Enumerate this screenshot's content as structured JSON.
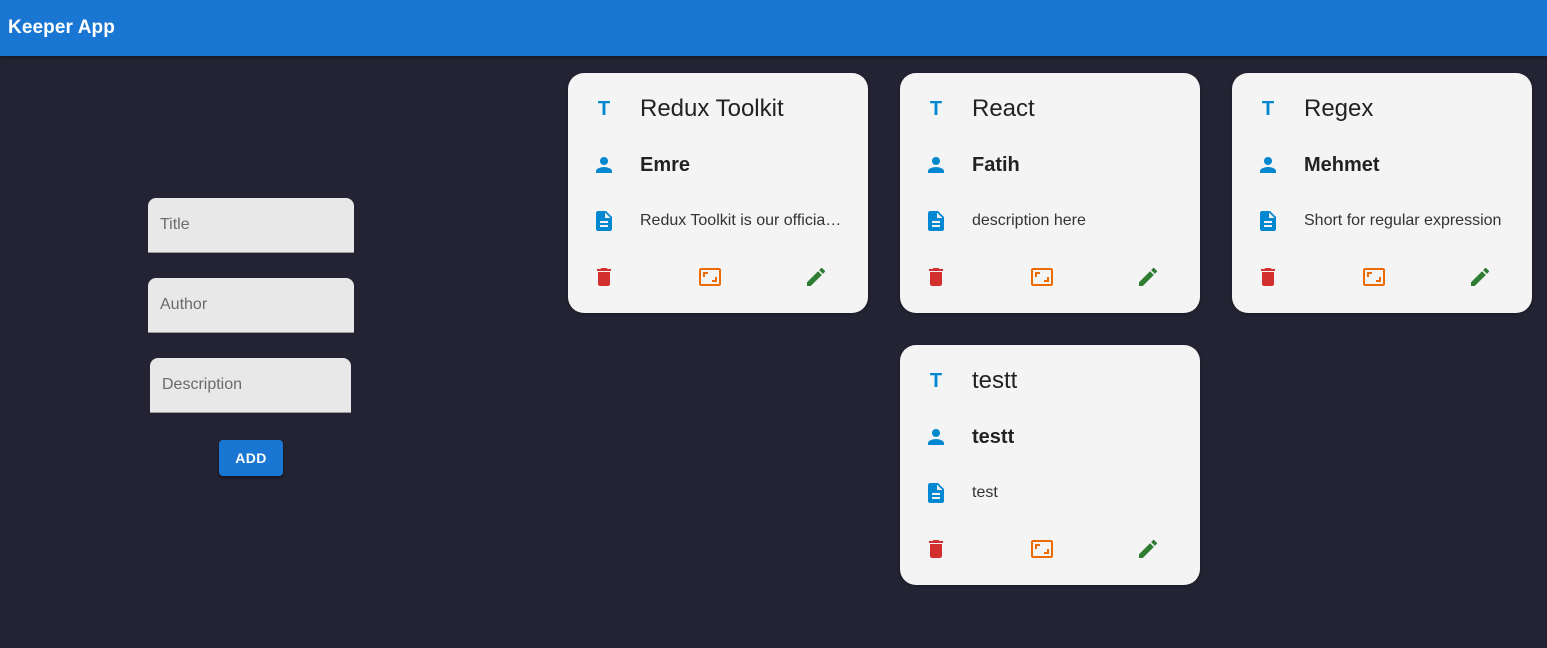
{
  "app": {
    "title": "Keeper App"
  },
  "form": {
    "title_placeholder": "Title",
    "author_placeholder": "Author",
    "description_placeholder": "Description",
    "add_label": "ADD"
  },
  "colors": {
    "appbar": "#1976d2",
    "background": "#232333",
    "card": "#f4f4f4",
    "info_icon": "#0288d1",
    "delete_icon": "#d32f2f",
    "expand_icon": "#ed6c02",
    "edit_icon": "#2e7d32"
  },
  "notes": [
    {
      "title": "Redux Toolkit",
      "author": "Emre",
      "description": "Redux Toolkit is our official recommended approach"
    },
    {
      "title": "React",
      "author": "Fatih",
      "description": "description here"
    },
    {
      "title": "Regex",
      "author": "Mehmet",
      "description": "Short for regular expression"
    },
    {
      "title": "testt",
      "author": "testt",
      "description": "test"
    }
  ],
  "icons": {
    "title": "title-icon",
    "author": "person-icon",
    "description": "description-icon",
    "delete": "delete-icon",
    "expand": "aspect-ratio-icon",
    "edit": "edit-icon"
  }
}
